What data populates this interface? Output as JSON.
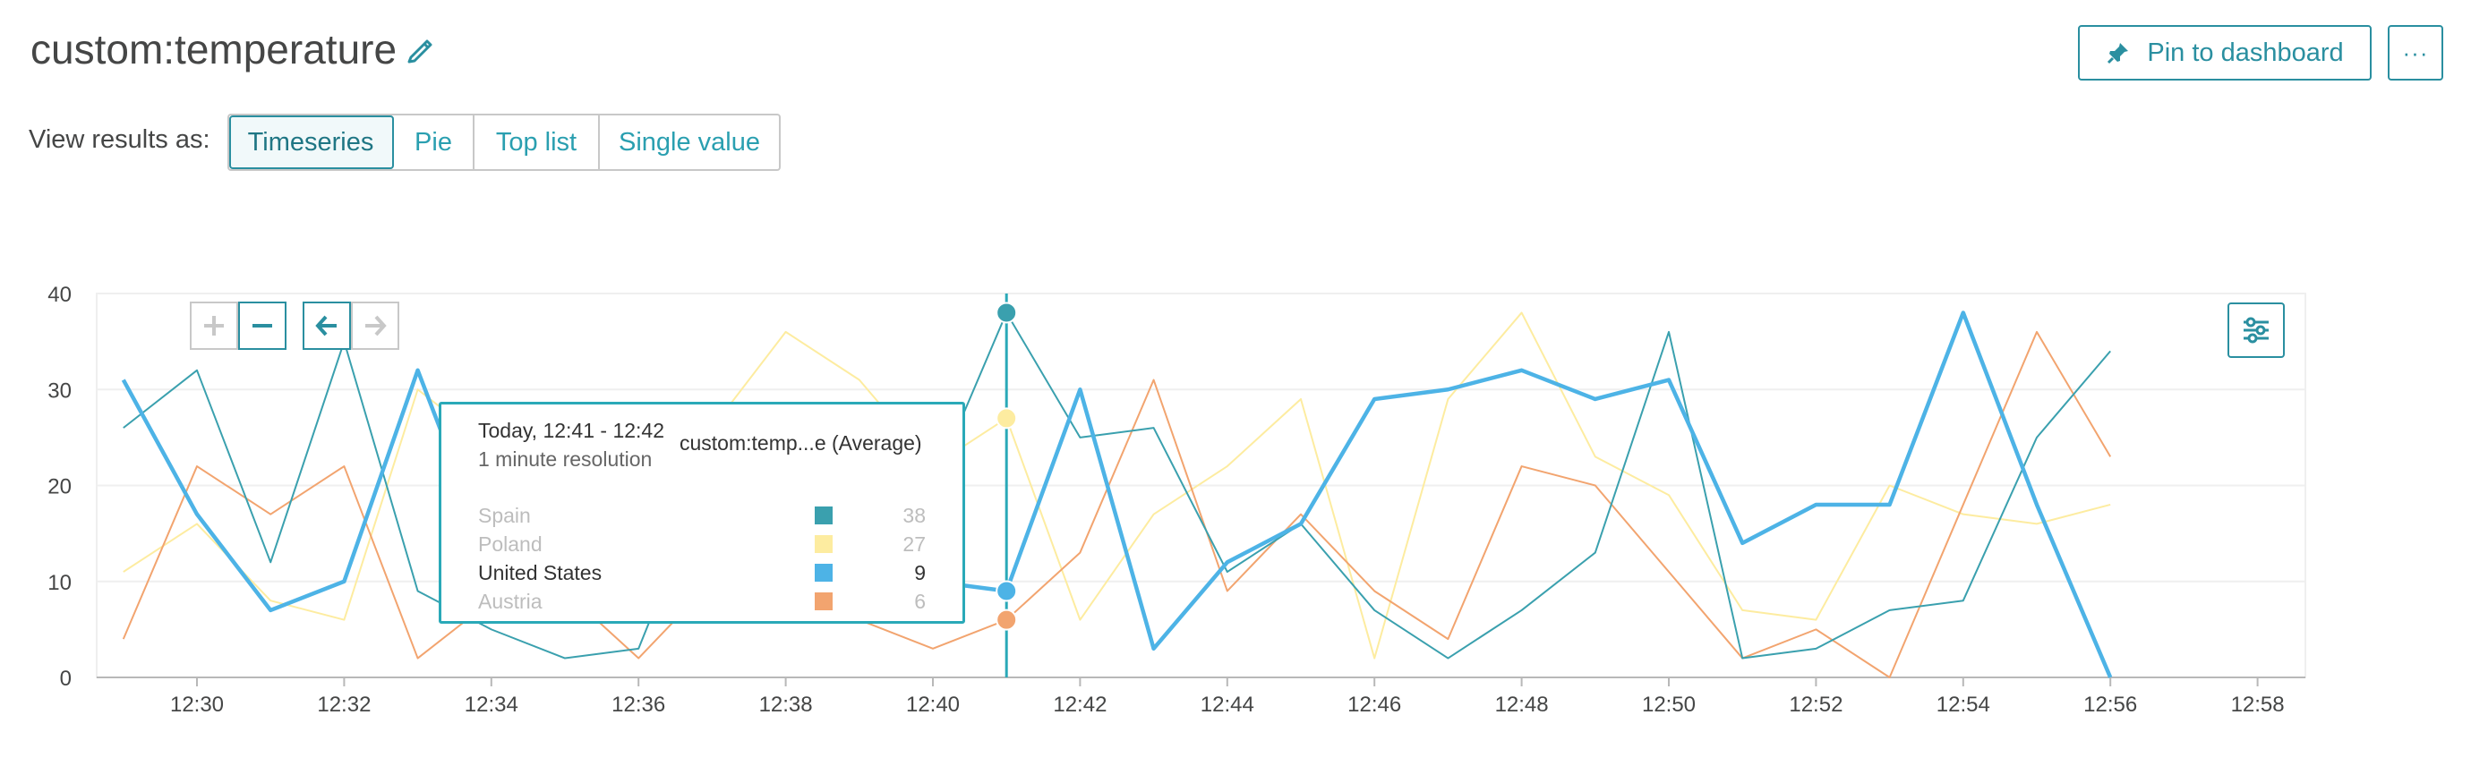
{
  "header": {
    "title": "custom:temperature",
    "pin_label": "Pin to dashboard",
    "more_label": "···"
  },
  "view": {
    "label": "View results as:",
    "options": [
      "Timeseries",
      "Pie",
      "Top list",
      "Single value"
    ],
    "selected": "Timeseries"
  },
  "tooltip": {
    "time": "Today, 12:41 - 12:42",
    "resolution": "1 minute resolution",
    "metric": "custom:temp...e (Average)",
    "rows": [
      {
        "name": "Spain",
        "value": "38",
        "color": "#3aa0ae"
      },
      {
        "name": "Poland",
        "value": "27",
        "color": "#fdeca0"
      },
      {
        "name": "United States",
        "value": "9",
        "color": "#4db3e6"
      },
      {
        "name": "Austria",
        "value": "6",
        "color": "#f2a46f"
      }
    ]
  },
  "colors": {
    "accent": "#2a8fa0",
    "spain": "#3aa0ae",
    "poland": "#fdeca0",
    "united_states": "#4db3e6",
    "austria": "#f2a46f"
  },
  "chart_data": {
    "type": "line",
    "x_unit": "minutes",
    "x": [
      "12:29",
      "12:30",
      "12:31",
      "12:32",
      "12:33",
      "12:34",
      "12:35",
      "12:36",
      "12:37",
      "12:38",
      "12:39",
      "12:40",
      "12:41",
      "12:42",
      "12:43",
      "12:44",
      "12:45",
      "12:46",
      "12:47",
      "12:48",
      "12:49",
      "12:50",
      "12:51",
      "12:52",
      "12:53",
      "12:54",
      "12:55",
      "12:56"
    ],
    "x_ticks": [
      "12:30",
      "12:32",
      "12:34",
      "12:36",
      "12:38",
      "12:40",
      "12:42",
      "12:44",
      "12:46",
      "12:48",
      "12:50",
      "12:52",
      "12:54",
      "12:56",
      "12:58"
    ],
    "y_ticks": [
      0,
      10,
      20,
      30,
      40
    ],
    "ylim": [
      0,
      40
    ],
    "highlight_x": "12:41",
    "series": [
      {
        "name": "Spain",
        "values": [
          26,
          32,
          12,
          35,
          9,
          5,
          2,
          3,
          22,
          20,
          18,
          20,
          38,
          25,
          26,
          11,
          16,
          7,
          2,
          7,
          13,
          36,
          2,
          3,
          7,
          8,
          25,
          34
        ]
      },
      {
        "name": "Poland",
        "values": [
          11,
          16,
          8,
          6,
          30,
          24,
          22,
          19,
          26,
          36,
          31,
          22,
          27,
          6,
          17,
          22,
          29,
          2,
          29,
          38,
          23,
          19,
          7,
          6,
          20,
          17,
          16,
          18
        ]
      },
      {
        "name": "United States",
        "values": [
          31,
          17,
          7,
          10,
          32,
          12,
          14,
          18,
          15,
          12,
          11,
          10,
          9,
          30,
          3,
          12,
          16,
          29,
          30,
          32,
          29,
          31,
          14,
          18,
          18,
          38,
          18,
          0
        ]
      },
      {
        "name": "Austria",
        "values": [
          4,
          22,
          17,
          22,
          2,
          8,
          9,
          2,
          10,
          8,
          6,
          3,
          6,
          13,
          31,
          9,
          17,
          9,
          4,
          22,
          20,
          11,
          2,
          5,
          0,
          18,
          36,
          23
        ]
      }
    ]
  }
}
